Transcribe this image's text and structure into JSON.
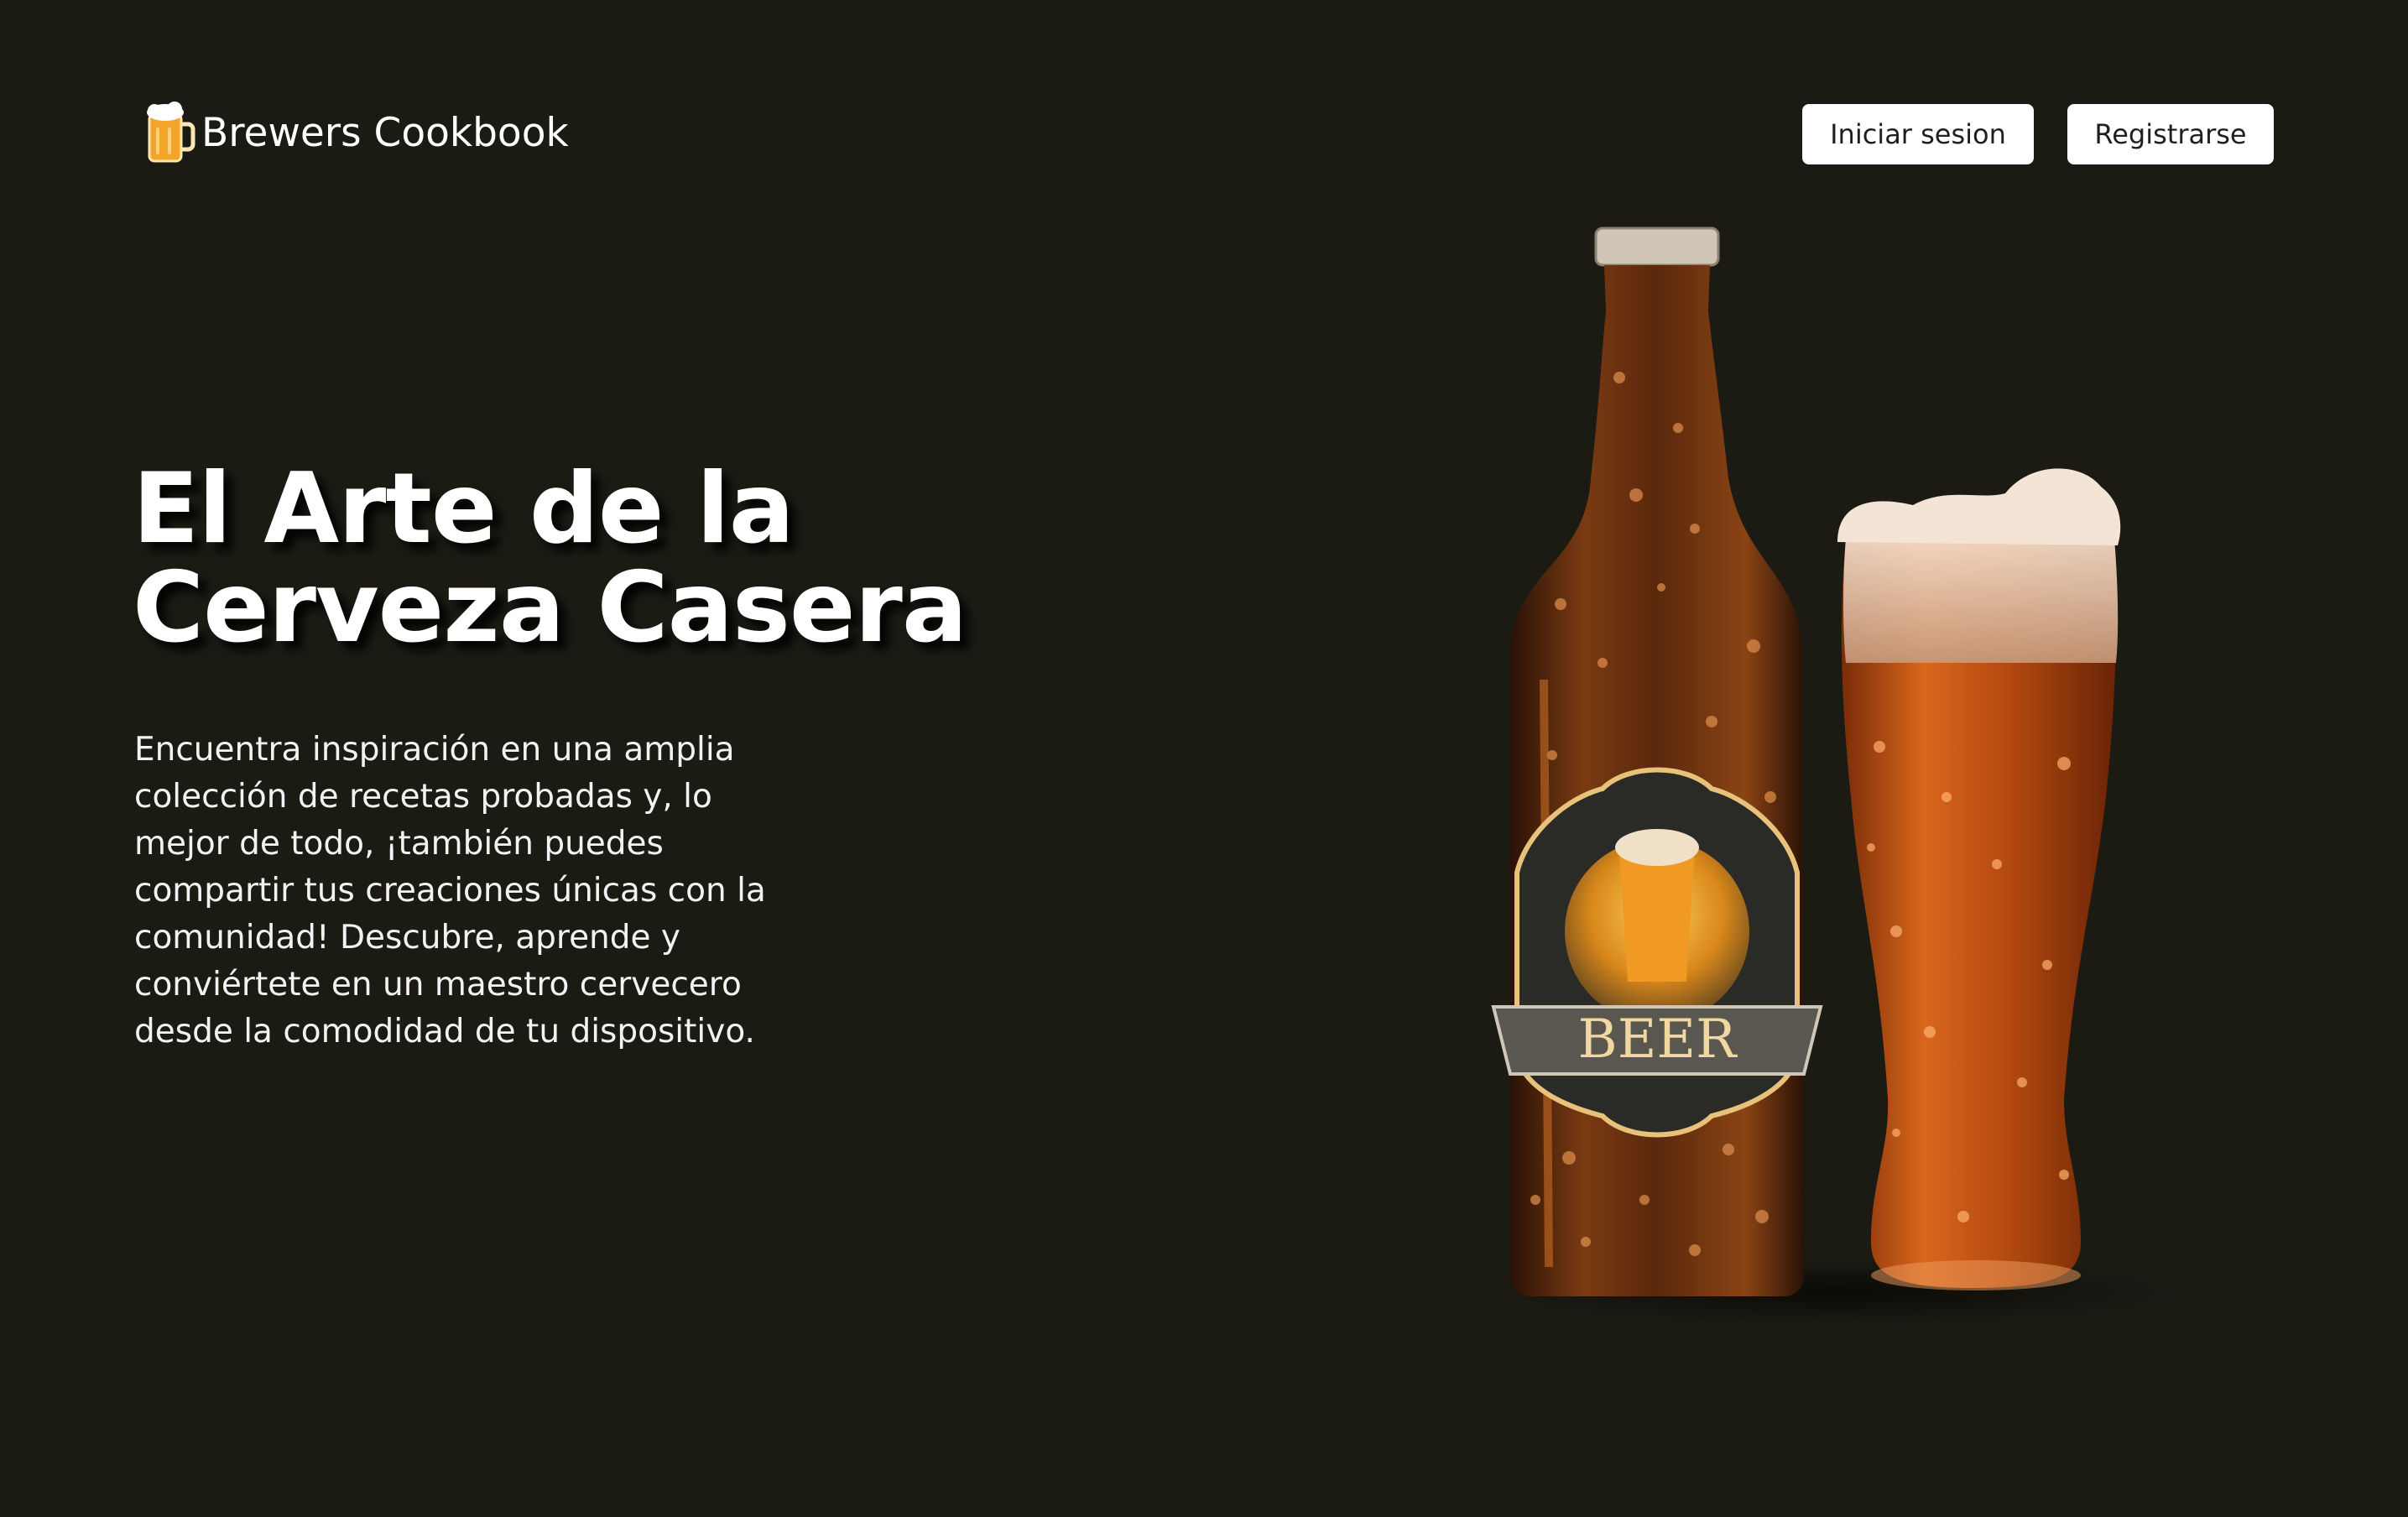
{
  "header": {
    "brand_name": "Brewers Cookbook",
    "brand_icon": "beer-mug-icon",
    "login_label": "Iniciar sesion",
    "register_label": "Registrarse"
  },
  "hero": {
    "title_line1": "El Arte de la",
    "title_line2": "Cerveza Casera",
    "description": "Encuentra inspiración en una amplia colección de recetas probadas y, lo mejor de todo, ¡también puedes compartir tus creaciones únicas con la comunidad! Descubre, aprende y conviértete en un maestro cervecero desde la comodidad de tu dispositivo.",
    "image": {
      "label_text": "BEER",
      "subject": "beer-bottle-and-glass"
    }
  },
  "colors": {
    "background": "#1b1a13",
    "text": "#ffffff",
    "button_bg": "#ffffff",
    "button_text": "#1f1f1f",
    "beer_amber": "#c2601a",
    "bottle_brown": "#4a2410"
  }
}
